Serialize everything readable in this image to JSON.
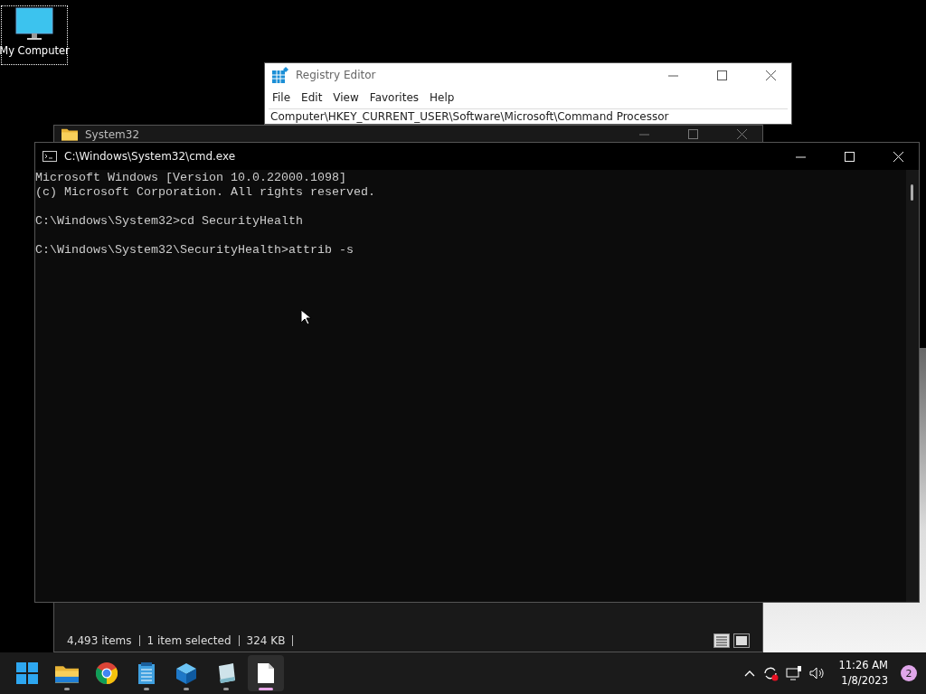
{
  "desktop_icons": [
    {
      "label": "My Computer",
      "selected": true
    }
  ],
  "windows": [
    {
      "kind": "regedit",
      "title": "Registry Editor",
      "menu": [
        "File",
        "Edit",
        "View",
        "Favorites",
        "Help"
      ],
      "address": "Computer\\HKEY_CURRENT_USER\\Software\\Microsoft\\Command Processor"
    },
    {
      "kind": "explorer",
      "title": "System32",
      "status": [
        "4,493 items",
        "1 item selected",
        "324 KB"
      ]
    },
    {
      "kind": "console",
      "title": "C:\\Windows\\System32\\cmd.exe",
      "blocks": [
        [
          "Microsoft Windows [Version 10.0.22000.1098]",
          "(c) Microsoft Corporation. All rights reserved."
        ],
        [
          "C:\\Windows\\System32>cd SecurityHealth"
        ],
        [
          "C:\\Windows\\System32\\SecurityHealth>attrib -s"
        ]
      ]
    }
  ],
  "taskbar": {
    "apps": [
      {
        "kind": "start",
        "running": false,
        "selected": false
      },
      {
        "kind": "folder",
        "running": true,
        "selected": false
      },
      {
        "kind": "chrome",
        "running": false,
        "selected": false
      },
      {
        "kind": "notepad",
        "running": true,
        "selected": false
      },
      {
        "kind": "cube",
        "running": true,
        "selected": false
      },
      {
        "kind": "pad",
        "running": true,
        "selected": false
      },
      {
        "kind": "file",
        "running": true,
        "selected": true
      }
    ],
    "clock": {
      "time": "11:26 AM",
      "date": "1/8/2023"
    },
    "notifications": "2"
  }
}
